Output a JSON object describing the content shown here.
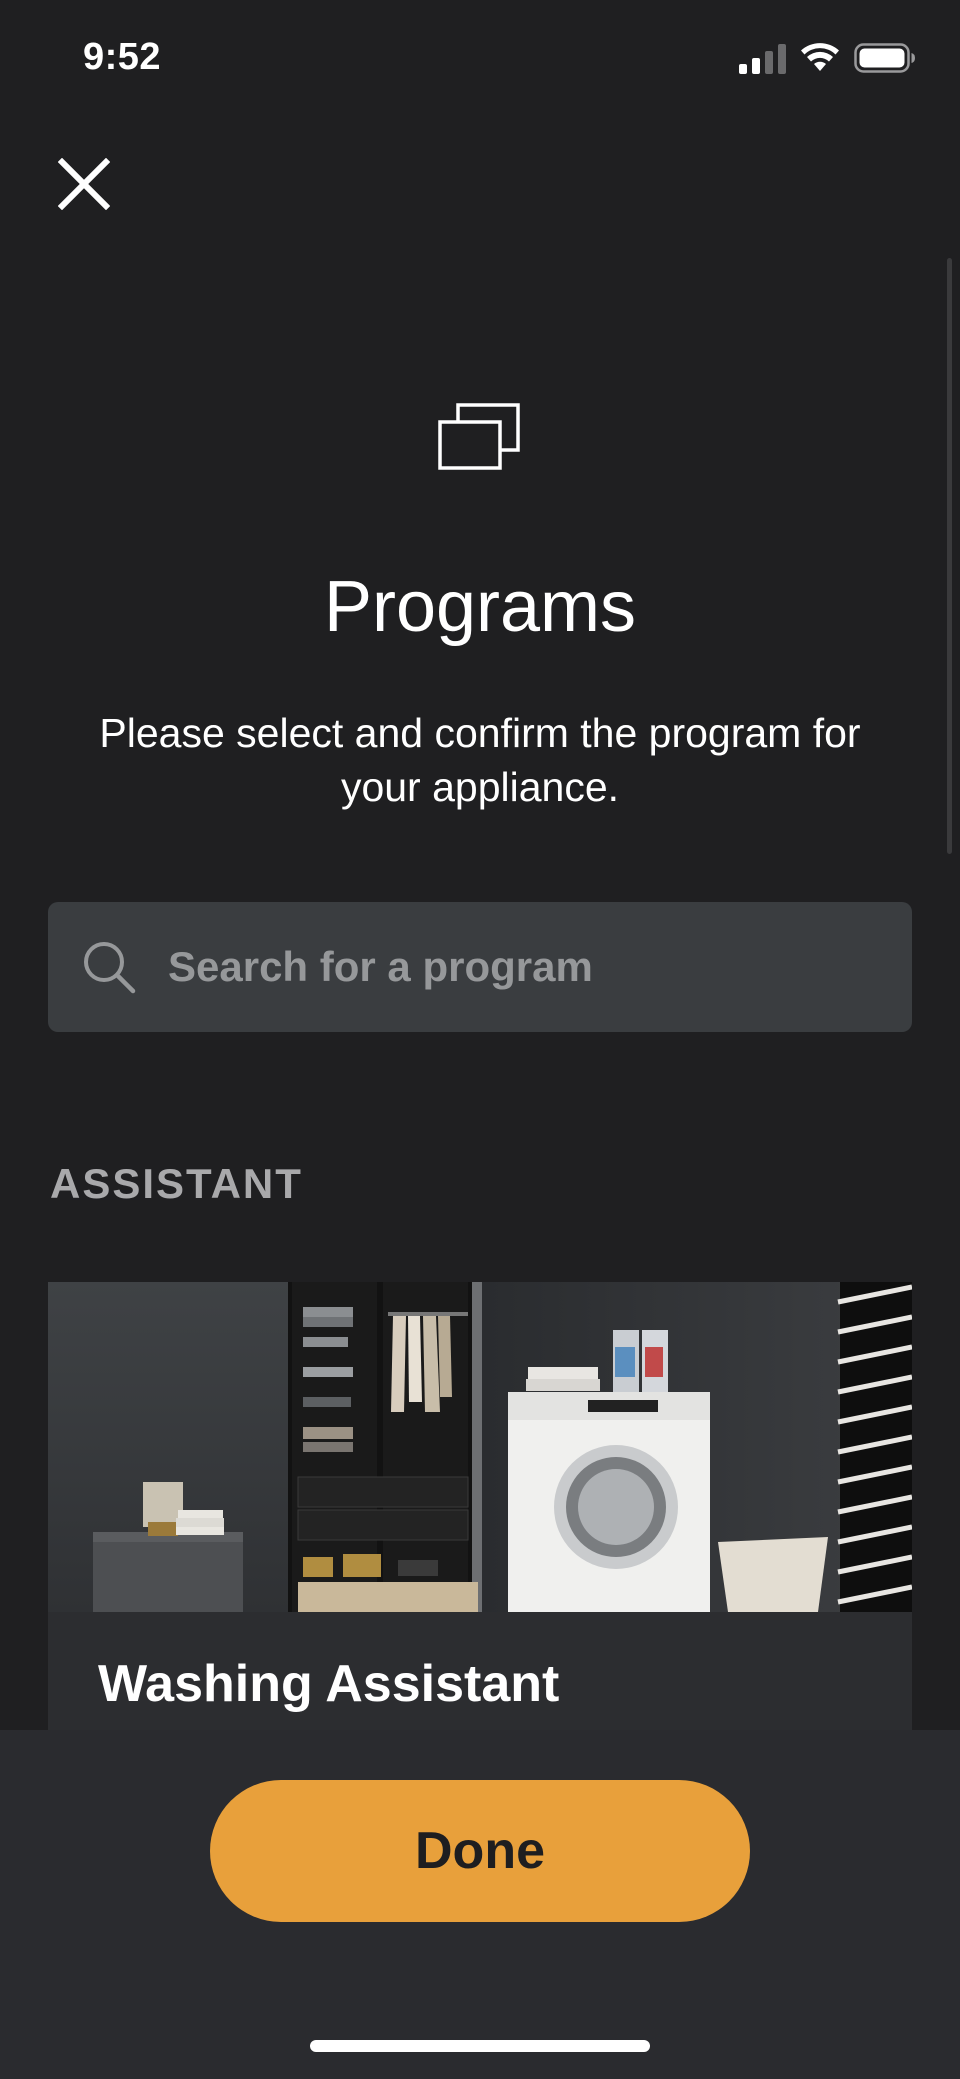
{
  "status_bar": {
    "time": "9:52",
    "icons": [
      "cellular-signal-icon",
      "wifi-icon",
      "battery-icon"
    ]
  },
  "header": {
    "close_icon": "close-icon",
    "programs_icon": "programs-stack-icon",
    "title": "Programs",
    "subtitle": "Please select and confirm the program for your appliance."
  },
  "search": {
    "placeholder": "Search for a program",
    "value": ""
  },
  "sections": [
    {
      "header": "ASSISTANT",
      "cards": [
        {
          "title": "Washing Assistant",
          "image": "laundry-room-with-washing-machine"
        }
      ]
    }
  ],
  "footer": {
    "done_label": "Done"
  },
  "colors": {
    "background": "#1f1f21",
    "accent": "#e8a03b",
    "search_background": "#3a3d40",
    "section_header": "#a9a9ab"
  }
}
